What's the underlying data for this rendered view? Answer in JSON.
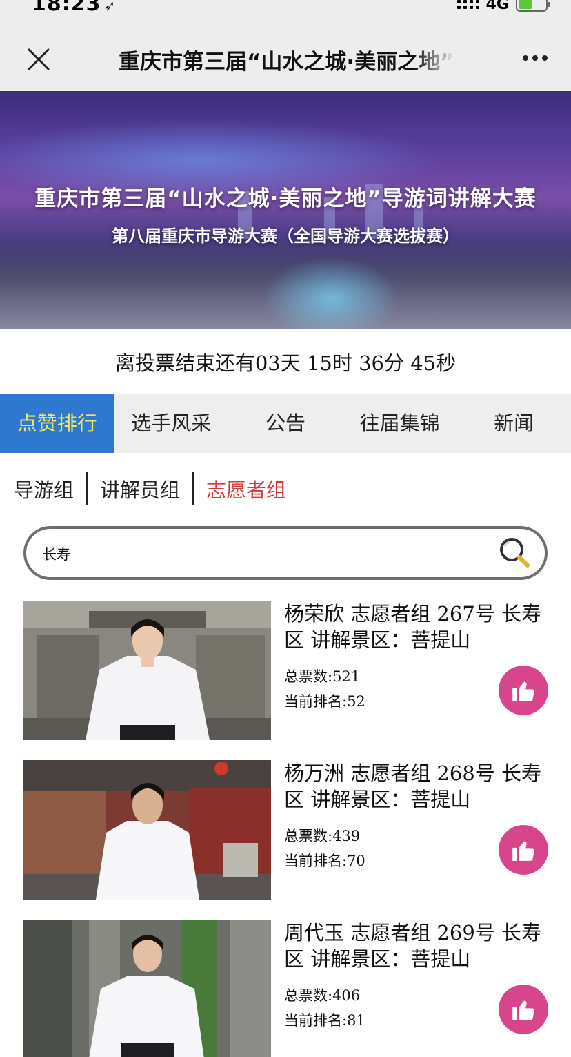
{
  "status_bar": {
    "time": "18:23",
    "network": "4G"
  },
  "nav": {
    "title": "重庆市第三届“山水之城·美丽之地”导游词讲解大赛"
  },
  "banner": {
    "title": "重庆市第三届“山水之城·美丽之地”导游词讲解大赛",
    "subtitle": "第八届重庆市导游大赛（全国导游大赛选拔赛）"
  },
  "countdown": "离投票结束还有03天 15时 36分 45秒",
  "tabs": [
    {
      "label": "点赞排行"
    },
    {
      "label": "选手风采"
    },
    {
      "label": "公告"
    },
    {
      "label": "往届集锦"
    },
    {
      "label": "新闻"
    }
  ],
  "groups": [
    {
      "label": "导游组"
    },
    {
      "label": "讲解员组"
    },
    {
      "label": "志愿者组"
    }
  ],
  "search": {
    "value": "长寿"
  },
  "contestants": [
    {
      "title": "杨荣欣 志愿者组 267号 长寿区 讲解景区：菩提山",
      "votes": "总票数:521",
      "rank": "当前排名:52"
    },
    {
      "title": "杨万洲 志愿者组 268号 长寿区 讲解景区：菩提山",
      "votes": "总票数:439",
      "rank": "当前排名:70"
    },
    {
      "title": "周代玉 志愿者组 269号 长寿区 讲解景区：菩提山",
      "votes": "总票数:406",
      "rank": "当前排名:81"
    }
  ],
  "colors": {
    "active_tab_bg": "#2f78d0",
    "active_tab_text": "#f4e85a",
    "active_group": "#d2393a",
    "like_button": "#d9458a"
  }
}
